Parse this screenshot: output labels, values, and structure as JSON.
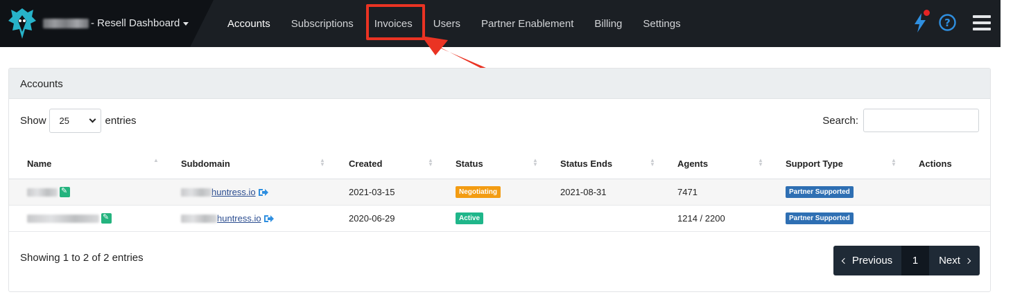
{
  "navbar": {
    "brand_label": "- Resell Dashboard",
    "items": [
      {
        "label": "Accounts",
        "active": true
      },
      {
        "label": "Subscriptions",
        "active": false
      },
      {
        "label": "Invoices",
        "active": false,
        "highlighted": true
      },
      {
        "label": "Users",
        "active": false
      },
      {
        "label": "Partner Enablement",
        "active": false
      },
      {
        "label": "Billing",
        "active": false
      },
      {
        "label": "Settings",
        "active": false
      }
    ],
    "icons": [
      "logo-icon",
      "bolt-icon",
      "help-icon",
      "hamburger-menu-icon"
    ],
    "annotation_color": "#ea3323"
  },
  "card": {
    "title": "Accounts",
    "show_label": "Show",
    "entries_value": "25",
    "entries_label": "entries",
    "search_label": "Search:",
    "search_placeholder": ""
  },
  "table": {
    "columns": [
      "Name",
      "Subdomain",
      "Created",
      "Status",
      "Status Ends",
      "Agents",
      "Support Type",
      "Actions"
    ],
    "rows": [
      {
        "subdomain_suffix": "huntress.io",
        "created": "2021-03-15",
        "status": "Negotiating",
        "status_color": "#f39c12",
        "status_ends": "2021-08-31",
        "agents": "7471",
        "support_type": "Partner Supported"
      },
      {
        "subdomain_suffix": "huntress.io",
        "created": "2020-06-29",
        "status": "Active",
        "status_color": "#1fb68a",
        "status_ends": "",
        "agents": "1214 / 2200",
        "support_type": "Partner Supported"
      }
    ]
  },
  "footer": {
    "info": "Showing 1 to 2 of 2 entries",
    "prev_label": "Previous",
    "page": "1",
    "next_label": "Next"
  }
}
